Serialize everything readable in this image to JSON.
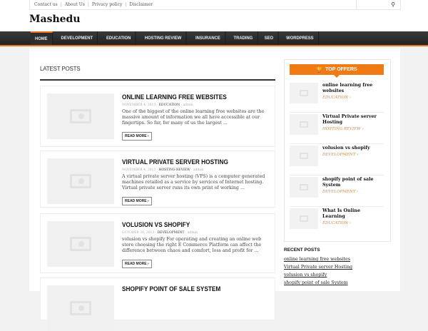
{
  "topbar": {
    "links": [
      "Contact us",
      "About Us",
      "Privacy policy",
      "Disclaimer"
    ]
  },
  "site": {
    "logo": "Mashedu"
  },
  "nav": [
    "HOME",
    "DEVELOPMENT",
    "EDUCATION",
    "HOSTING REVIEW",
    "INSURANCE",
    "TRADING",
    "SEO",
    "WORDPRESS"
  ],
  "main": {
    "heading": "LATEST POSTS",
    "read_more": "READ MORE ›",
    "posts": [
      {
        "title": "ONLINE LEARNING FREE WEBSITES",
        "date": "NOVEMBER 4, 2013",
        "category": "EDUCATION",
        "author": "admin",
        "excerpt": "One of the biggest of the online learning free websites are the massive amount of information we all have accessible at our fingertips. So far, for many of us the largest ..."
      },
      {
        "title": "VIRTUAL PRIVATE SERVER HOSTING",
        "date": "NOVEMBER 4, 2013",
        "category": "HOSTING REVIEW",
        "author": "admin",
        "excerpt": "A virtual private server hosting (VPS) is a computer generated machines retailed as a service by services of Internet hosting. Virtual private server runs its own print of working ..."
      },
      {
        "title": "VOLUSION VS SHOPIFY",
        "date": "OCTOBER 28, 2013",
        "category": "DEVELOPMENT",
        "author": "admin",
        "excerpt": "volusion vs shopify For operating and creating an online web store choosing the right E Commerce Platform can affect the difference between chaos and comfort, loss and profit for ..."
      },
      {
        "title": "SHOPIFY POINT OF SALE SYSTEM"
      }
    ]
  },
  "sidebar": {
    "offers_title": "TOP OFFERS",
    "offers": [
      {
        "title": "online learning free websites",
        "category": "EDUCATION ›"
      },
      {
        "title": "Virtual Private server Hosting",
        "category": "HOSTING REVIEW ›"
      },
      {
        "title": "volusion vs shopify",
        "category": "DEVELOPMENT ›"
      },
      {
        "title": "shopify point of sale System",
        "category": "DEVELOPMENT ›"
      },
      {
        "title": "What Is Online Learning",
        "category": "EDUCATION ›"
      }
    ],
    "recent_title": "RECENT POSTS",
    "recent": [
      "online learning free websites",
      "Virtual Private server Hosting",
      "volusion vs shopify",
      "shopify point of sale System"
    ]
  }
}
